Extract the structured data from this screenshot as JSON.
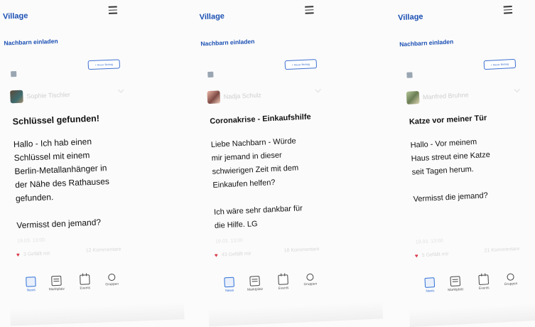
{
  "app": {
    "brand": "Village",
    "invite_label": "Nachbarn einladen",
    "new_post_label": "+ Neuer Beitrag"
  },
  "accent_color": "#1a4fb3",
  "heart_color": "#d93a4a",
  "nav": {
    "items": [
      {
        "label": "News",
        "icon": "news-icon",
        "active": true
      },
      {
        "label": "Marktplatz",
        "icon": "marketplace-icon",
        "active": false
      },
      {
        "label": "Events",
        "icon": "calendar-icon",
        "active": false
      },
      {
        "label": "Gruppen",
        "icon": "groups-icon",
        "active": false
      }
    ]
  },
  "screens": [
    {
      "author": "Sophie Tischler",
      "title": "Schlüssel gefunden!",
      "body": "Hallo - Ich hab einen\nSchlüssel mit einem\nBerlin-Metallanhänger in\nder Nähe des Rathauses\ngefunden.\n\nVermisst den jemand?",
      "timestamp": "19.03. 13:00",
      "likes": "3 Gefällt mir",
      "comments": "12 Kommentare"
    },
    {
      "author": "Nadja Schulz",
      "title": "Coronakrise - Einkaufshilfe",
      "body": "Liebe Nachbarn - Würde\nmir jemand in dieser\nschwierigen Zeit mit dem\nEinkaufen helfen?\n\nIch wäre sehr dankbar für\ndie Hilfe. LG",
      "timestamp": "19.03. 13:00",
      "likes": "43 Gefällt mir",
      "comments": "18 Kommentare"
    },
    {
      "author": "Manfred Bruhne",
      "title": "Katze vor meiner Tür",
      "body": "Hallo - Vor meinem\nHaus streut eine Katze\nseit Tagen herum.\n\nVermisst die jemand?",
      "timestamp": "19.03. 13:00",
      "likes": "5 Gefällt mir",
      "comments": "21 Kommentare"
    }
  ]
}
